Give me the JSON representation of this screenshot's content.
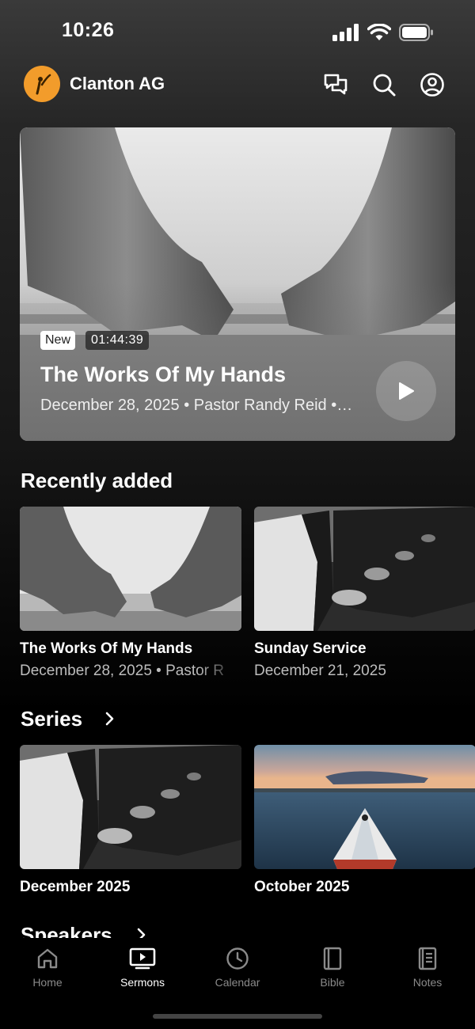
{
  "status": {
    "time": "10:26"
  },
  "header": {
    "church_name": "Clanton AG"
  },
  "hero": {
    "badge": "New",
    "duration": "01:44:39",
    "title": "The Works Of My Hands",
    "meta": "December 28, 2025 • Pastor Randy Reid •…"
  },
  "recent": {
    "heading": "Recently added",
    "items": [
      {
        "title": "The Works Of My Hands",
        "subtitle": "December 28, 2025 • Pastor R"
      },
      {
        "title": "Sunday Service",
        "subtitle": "December 21, 2025"
      }
    ]
  },
  "series": {
    "heading": "Series",
    "items": [
      {
        "title": "December 2025"
      },
      {
        "title": "October 2025"
      }
    ]
  },
  "speakers": {
    "heading": "Speakers"
  },
  "tabs": [
    {
      "label": "Home",
      "icon": "home-icon"
    },
    {
      "label": "Sermons",
      "icon": "tv-icon"
    },
    {
      "label": "Calendar",
      "icon": "clock-icon"
    },
    {
      "label": "Bible",
      "icon": "book-icon"
    },
    {
      "label": "Notes",
      "icon": "notes-icon"
    }
  ],
  "colors": {
    "brand": "#f29c2b",
    "background": "#000000",
    "tab_active": "#ffffff",
    "tab_inactive": "#8a8a8a"
  }
}
